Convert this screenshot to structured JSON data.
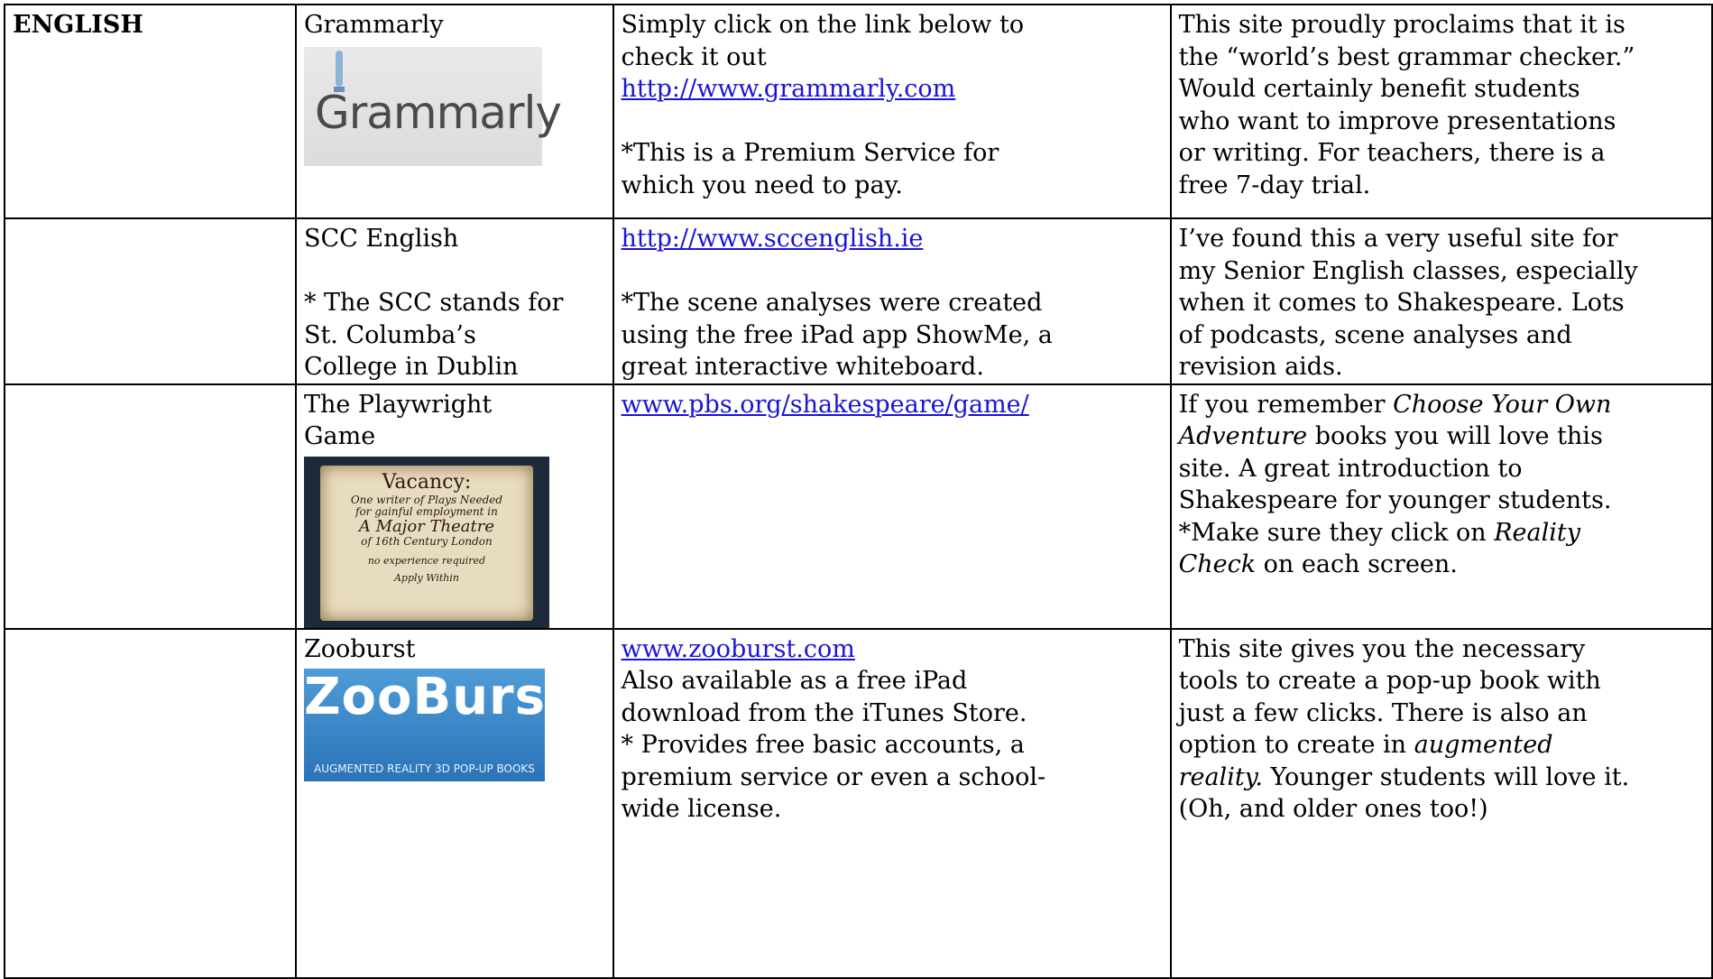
{
  "rows": [
    {
      "subject": "ENGLISH",
      "name_lines": [
        "Grammarly"
      ],
      "logo": {
        "name": "grammarly-logo",
        "text": "Grammarly"
      },
      "info_lines": [
        "Simply click on the link below to",
        "check it out"
      ],
      "link": "http://www.grammarly.com",
      "note_lines": [
        "*This is a Premium Service for",
        "which you need to pay."
      ],
      "desc": [
        "This site proudly proclaims that it is",
        "the “world’s best grammar checker.”",
        "Would certainly benefit students",
        "who want to improve presentations",
        "or writing. For teachers, there is a",
        "free 7-day trial."
      ]
    },
    {
      "subject": "",
      "name_lines": [
        "SCC English"
      ],
      "name_note_lines": [
        "* The SCC stands for",
        "St. Columba’s",
        "College in Dublin"
      ],
      "link": "http://www.sccenglish.ie",
      "note_lines": [
        "*The scene analyses were created",
        "using the free iPad app ShowMe, a",
        "great interactive whiteboard."
      ],
      "desc": [
        "I’ve found this a very useful site for",
        "my Senior English classes, especially",
        "when it comes to Shakespeare. Lots",
        "of podcasts, scene analyses and",
        "revision aids."
      ]
    },
    {
      "subject": "",
      "name_lines": [
        "The Playwright",
        "Game"
      ],
      "logo": {
        "name": "vacancy-poster",
        "title": "Vacancy:",
        "l1": "One writer of Plays Needed",
        "l2": "for gainful employment in",
        "l3": "A Major Theatre",
        "l4": "of 16th Century London",
        "l5": "no experience required",
        "l6": "Apply Within"
      },
      "link": "www.pbs.org/shakespeare/game/",
      "desc_parts": {
        "a": "If you remember ",
        "a_em": "Choose Your Own",
        "b_em": "Adventure",
        "b": " books you will love this",
        "c": "site. A great introduction to",
        "d": "Shakespeare for younger students.",
        "e": "*Make sure they click on ",
        "e_em": "Reality",
        "f_em": "Check",
        "f": " on each screen."
      }
    },
    {
      "subject": "",
      "name_lines": [
        "Zooburst"
      ],
      "logo": {
        "name": "zooburst-logo",
        "text": "ZooBurst",
        "sub": "AUGMENTED REALITY 3D POP-UP BOOKS"
      },
      "link": "www.zooburst.com",
      "info_lines": [
        "Also available as a free iPad",
        "download from the iTunes Store.",
        "* Provides free basic accounts, a",
        "premium service or even a school-",
        "wide license."
      ],
      "desc_parts": {
        "a": "This site gives you the necessary",
        "b": "tools to create a pop-up book with",
        "c": "just a few clicks. There is also an",
        "d": "option to create in ",
        "d_em": "augmented",
        "e_em": "reality.",
        "e": " Younger students will love it.",
        "f": "(Oh, and older ones too!)"
      }
    }
  ]
}
